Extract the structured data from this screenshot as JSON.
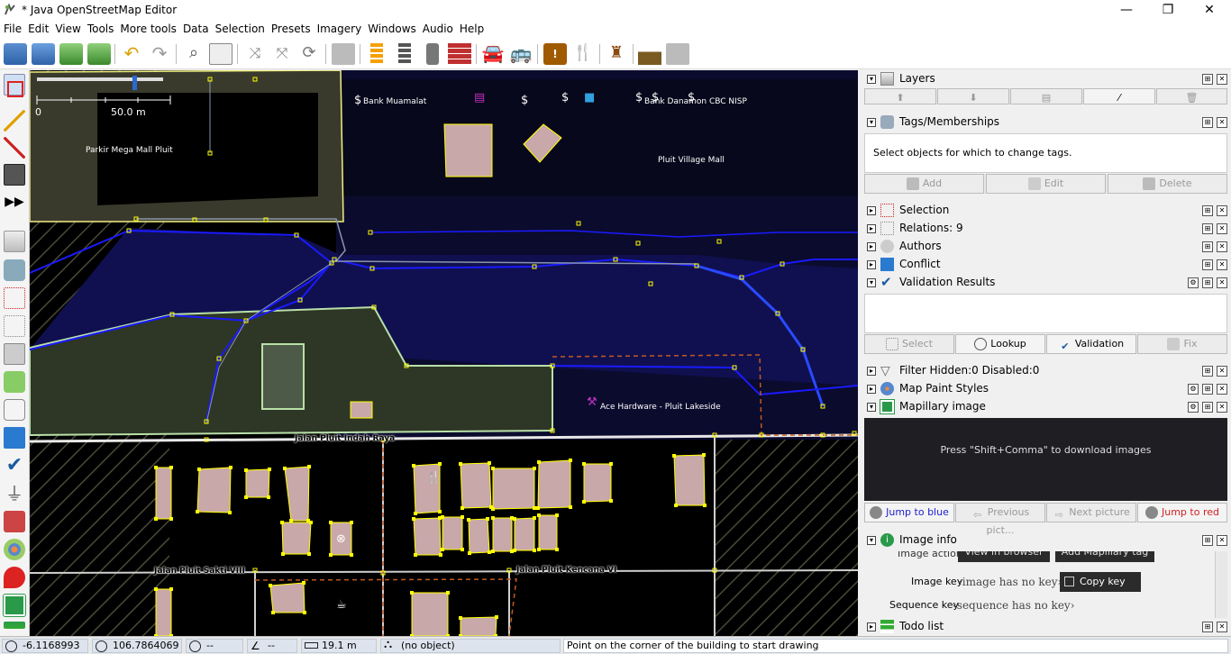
{
  "window": {
    "title": "* Java OpenStreetMap Editor",
    "minimize": "—",
    "maximize": "❐",
    "close": "✕"
  },
  "menu": [
    "File",
    "Edit",
    "View",
    "Tools",
    "More tools",
    "Data",
    "Selection",
    "Presets",
    "Imagery",
    "Windows",
    "Audio",
    "Help"
  ],
  "toolbar": [
    "open-icon",
    "download-icon",
    "download-data-icon",
    "upload-icon",
    "undo-icon",
    "redo-icon",
    "search-icon",
    "preferences-icon",
    "combine-way-icon",
    "split-way-icon",
    "refresh-icon",
    "disabled-icon",
    "preset-road-icon",
    "preset-track-icon",
    "preset-barrier-icon",
    "preset-wall-icon",
    "preset-car-icon",
    "preset-bus-icon",
    "preset-shop-icon",
    "preset-restaurant-icon",
    "preset-castle-icon",
    "preset-industry-icon",
    "preset-disabled-icon"
  ],
  "map": {
    "scale": {
      "zero": "0",
      "distance": "50.0 m"
    },
    "labels": {
      "parkir": "Parkir Mega Mall Pluit",
      "bank_muamalat": "Bank Muamalat",
      "bank_nisp": "Bank Danamon  CBC NISP",
      "pluit_village": "Pluit Village Mall",
      "ace": "Ace Hardware - Pluit Lakeside"
    },
    "roads": {
      "indah_raya": "Jalan Pluit Indah Raya",
      "sakti": "Jalan Pluit Sakti VIII",
      "kencana": "Jalan Pluit Kencana VI"
    }
  },
  "panels": {
    "layers": {
      "title": "Layers"
    },
    "tags": {
      "title": "Tags/Memberships",
      "message": "Select objects for which to change tags.",
      "add": "Add",
      "edit": "Edit",
      "delete": "Delete"
    },
    "selection": {
      "title": "Selection"
    },
    "relations": {
      "title": "Relations: 9"
    },
    "authors": {
      "title": "Authors"
    },
    "conflict": {
      "title": "Conflict"
    },
    "validation": {
      "title": "Validation Results",
      "select": "Select",
      "lookup": "Lookup",
      "validation": "Validation",
      "fix": "Fix"
    },
    "filter": {
      "title": "Filter Hidden:0 Disabled:0"
    },
    "mappaint": {
      "title": "Map Paint Styles"
    },
    "mapillary": {
      "title": "Mapillary image",
      "message": "Press \"Shift+Comma\" to download images",
      "jump_blue": "Jump to blue",
      "prev": "Previous pict...",
      "next": "Next picture",
      "jump_red": "Jump to red"
    },
    "imageinfo": {
      "title": "Image info",
      "image_actions": "Image actions",
      "view_browser": "View in browser",
      "add_tag": "Add Mapillary tag",
      "image_key_label": "Image key",
      "image_key_value": "‹image has no key›",
      "copy_key": "Copy key",
      "sequence_key_label": "Sequence key",
      "sequence_key_value": "‹sequence has no key›"
    },
    "todo": {
      "title": "Todo list"
    }
  },
  "status": {
    "lat": "-6.1168993",
    "lon": "106.7864069",
    "heading": "--",
    "angle": "--",
    "distance": "19.1 m",
    "object": "(no object)",
    "help": "Point on the corner of the building to start drawing"
  },
  "colors": {
    "selection_blue": "#0000ff",
    "node_yellow": "#ffff00",
    "building_fill": "#c8a8a8",
    "map_bg": "#000000",
    "landuse_green": "#3c4a30"
  }
}
